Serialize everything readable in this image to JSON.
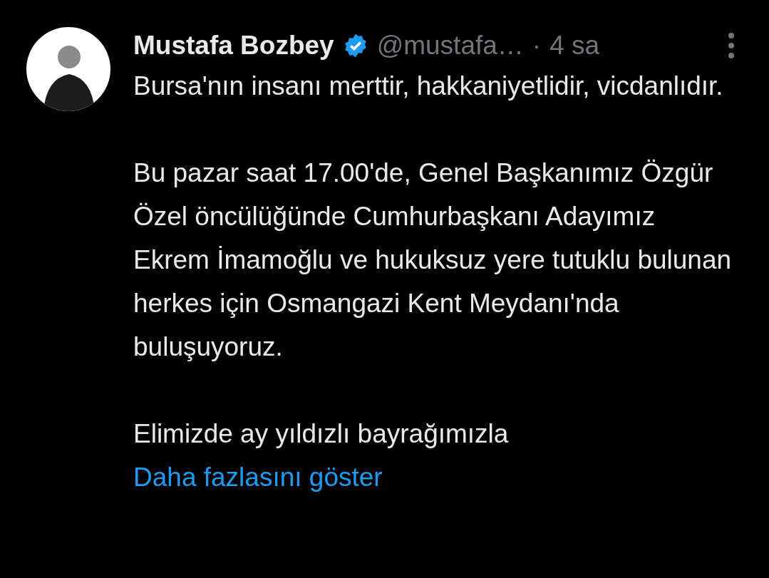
{
  "post": {
    "author": {
      "name": "Mustafa Bozbey",
      "verified": true,
      "handle": "@mustafa…",
      "separator": "·",
      "time": "4 sa"
    },
    "paragraphs": [
      "Bursa'nın insanı merttir, hakkaniyetlidir, vicdanlıdır.",
      "Bu pazar saat 17.00'de, Genel Başkanımız Özgür Özel öncülüğünde Cumhurbaşkanı Adayımız Ekrem İmamoğlu ve hukuksuz yere tutuklu bulunan herkes için Osmangazi Kent Meydanı'nda buluşuyoruz."
    ],
    "last_paragraph": {
      "text": "Elimizde ay yıldızlı bayrağımızla",
      "link": "Daha fazlasını göster"
    }
  }
}
